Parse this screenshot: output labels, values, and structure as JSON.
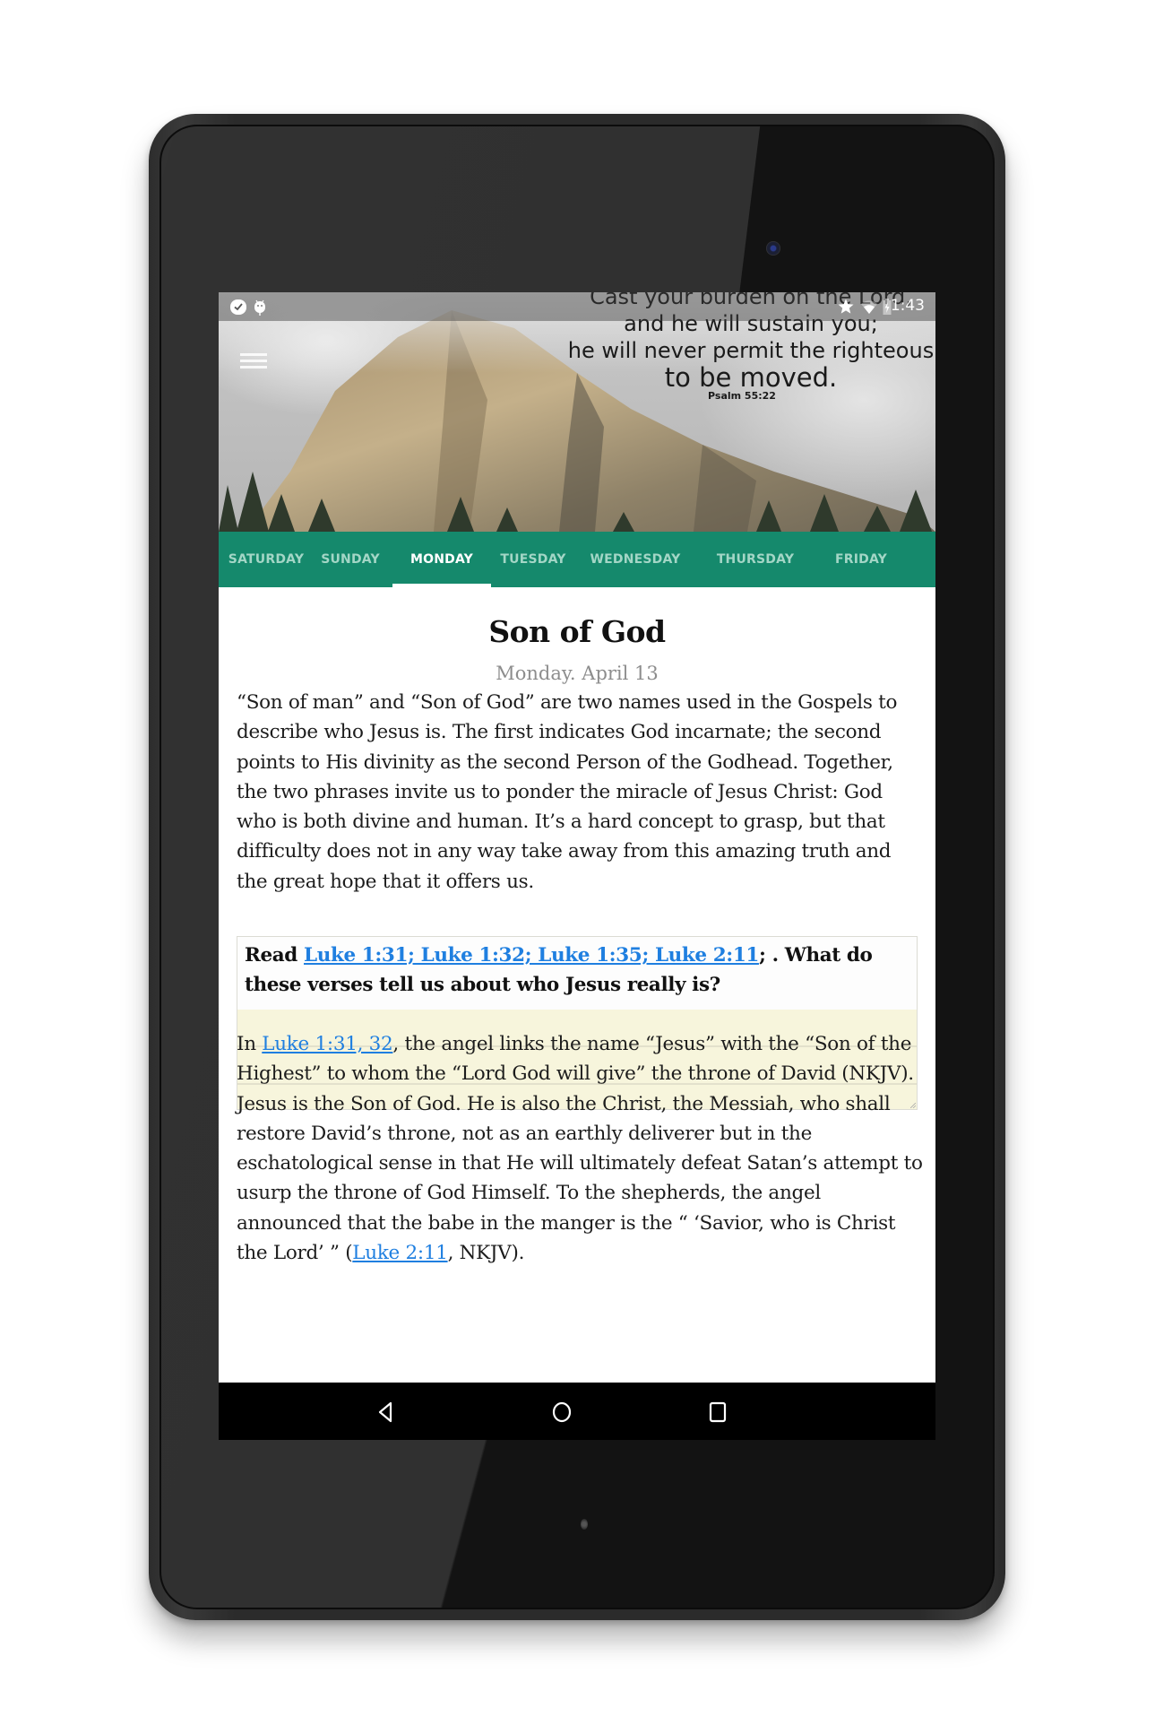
{
  "status_bar": {
    "left_icons": [
      "check-badge-icon",
      "android-debug-icon"
    ],
    "right_icons": [
      "star-icon",
      "wifi-icon",
      "battery-charging-icon"
    ],
    "time": "1:43"
  },
  "header": {
    "menu_icon": "hamburger-menu-icon",
    "verse_lines": [
      "Cast your burden on the Lord,",
      "and he will sustain you;",
      "he will never permit the righteous",
      "to be moved."
    ],
    "verse_reference": "Psalm 55:22"
  },
  "tabs": [
    {
      "label": "SATURDAY",
      "active": false
    },
    {
      "label": "SUNDAY",
      "active": false
    },
    {
      "label": "MONDAY",
      "active": true
    },
    {
      "label": "TUESDAY",
      "active": false
    },
    {
      "label": "WEDNESDAY",
      "active": false
    },
    {
      "label": "THURSDAY",
      "active": false
    },
    {
      "label": "FRIDAY",
      "active": false
    }
  ],
  "lesson": {
    "title": "Son of God",
    "date": "Monday. April 13",
    "intro": "“Son of man” and “Son of God” are two names used in the Gospels to describe who Jesus is. The first indicates God incarnate; the second points to His divinity as the second Person of the Godhead. Together, the two phrases invite us to ponder the miracle of Jesus Christ: God who is both divine and human. It’s a hard concept to grasp, but that difficulty does not in any way take away from this amazing truth and the great hope that it offers us.",
    "question": {
      "prefix": "Read ",
      "link": "Luke 1:31; Luke 1:32; Luke 1:35; Luke 2:11",
      "suffix": "; . What do these verses tell us about who Jesus really is?",
      "answer_value": ""
    },
    "body": {
      "part1": "In ",
      "link1": "Luke 1:31, 32",
      "part2": ", the angel links the name “Jesus” with the “Son of the Highest” to whom the “Lord God will give” the throne of David (NKJV). Jesus is the Son of God. He is also the Christ, the Messiah, who shall restore David’s throne, not as an earthly deliverer but in the eschatological sense in that He will ultimately defeat Satan’s attempt to usurp the throne of God Himself. To the shepherds, the angel announced that the babe in the manger is the “ ‘Savior, who is Christ the Lord’ ” (",
      "link2": "Luke 2:11",
      "part3": ", NKJV)."
    }
  },
  "nav_bar": {
    "buttons": [
      "back-icon",
      "home-icon",
      "recents-icon"
    ]
  },
  "colors": {
    "tab_bar": "#15896c",
    "tab_inactive_text": "#a3d6c6",
    "tab_active_text": "#ffffff",
    "link": "#1f7fe0",
    "answer_background": "#f7f5dc",
    "date_text": "#8d8d8d"
  }
}
